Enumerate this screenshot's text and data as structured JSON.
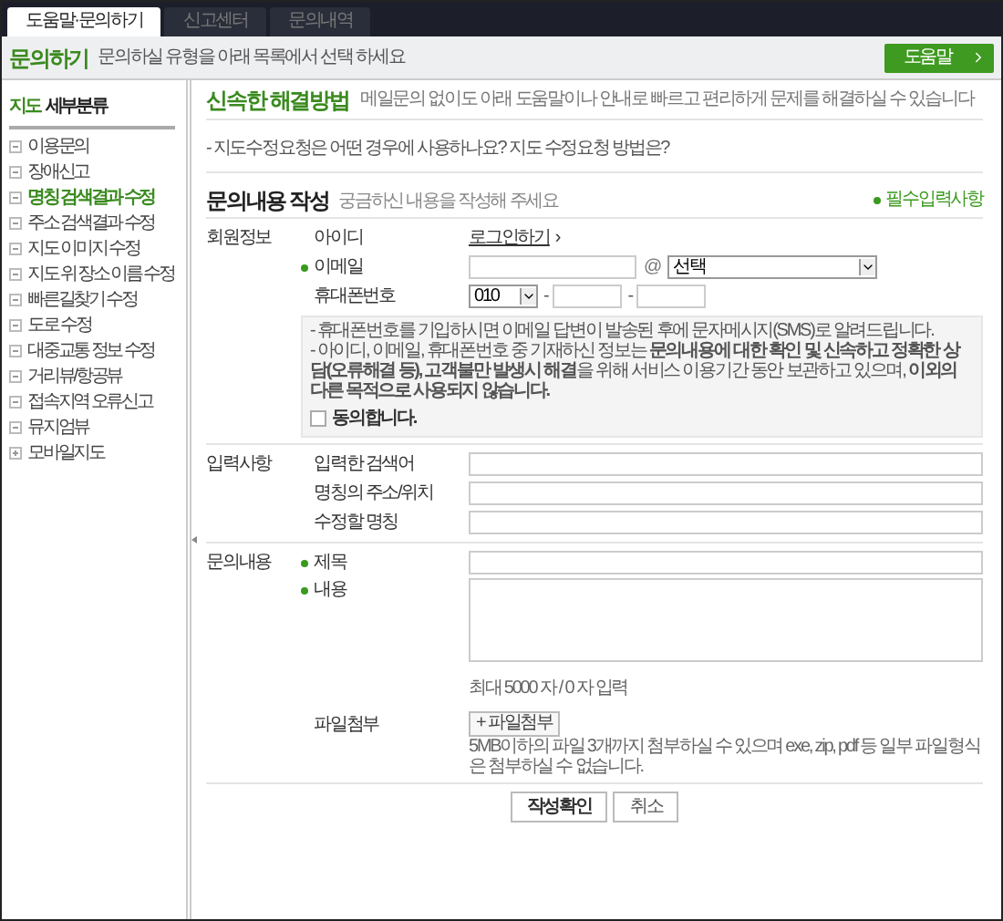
{
  "tabs": [
    {
      "label": "도움말·문의하기",
      "selected": true
    },
    {
      "label": "신고센터",
      "selected": false
    },
    {
      "label": "문의내역",
      "selected": false
    }
  ],
  "header": {
    "title": "문의하기",
    "subtitle": "문의하실 유형을 아래 목록에서 선택 하세요",
    "help_button": "도움말"
  },
  "sidebar": {
    "title_highlight": "지도",
    "title": "세부분류",
    "items": [
      {
        "label": "이용문의",
        "selected": false,
        "expanded": true
      },
      {
        "label": "장애신고",
        "selected": false,
        "expanded": true
      },
      {
        "label": "명칭 검색결과 수정",
        "selected": true,
        "expanded": true
      },
      {
        "label": "주소 검색결과 수정",
        "selected": false,
        "expanded": true
      },
      {
        "label": "지도 이미지 수정",
        "selected": false,
        "expanded": true
      },
      {
        "label": "지도 위 장소 이름 수정",
        "selected": false,
        "expanded": true
      },
      {
        "label": "빠른길찾기 수정",
        "selected": false,
        "expanded": true
      },
      {
        "label": "도로 수정",
        "selected": false,
        "expanded": true
      },
      {
        "label": "대중교통 정보 수정",
        "selected": false,
        "expanded": true
      },
      {
        "label": "거리뷰/항공뷰",
        "selected": false,
        "expanded": true
      },
      {
        "label": "접속지역 오류신고",
        "selected": false,
        "expanded": true
      },
      {
        "label": "뮤지엄뷰",
        "selected": false,
        "expanded": true
      },
      {
        "label": "모바일지도",
        "selected": false,
        "expanded": false
      }
    ]
  },
  "solution": {
    "title": "신속한 해결방법",
    "description": "메일문의 없이도 아래 도움말이나 안내로 빠르고 편리하게 문제를 해결하실 수 있습니다",
    "faq": "- 지도수정요청은 어떤 경우에 사용하나요? 지도 수정요청 방법은?"
  },
  "form": {
    "title": "문의내용 작성",
    "subtitle": "궁금하신 내용을 작성해 주세요",
    "required_note": "필수입력사항"
  },
  "member": {
    "label": "회원정보",
    "id_label": "아이디",
    "login_link": "로그인하기",
    "login_arrow": "›",
    "email": {
      "label": "이메일",
      "required": true,
      "at": "@",
      "domain": "선택"
    },
    "phone": {
      "label": "휴대폰번호",
      "prefix": "010",
      "dashes": [
        "-",
        "-"
      ]
    },
    "notice": [
      "- 휴대폰번호를 기입하시면 이메일 답변이 발송된 후에 문자메시지(SMS)로 알려드립니다.",
      "- 아이디, 이메일, 휴대폰번호 중 기재하신 정보는 **문의내용에 대한 확인 및 신속하고 정확한 상담(오류해결 등), 고객불만 발생시 해결**을 위해 서비스 이용기간 동안 보관하고 있으며, **이외의 다른 목적으로 사용되지 않습니다.**"
    ],
    "agree": {
      "label": "동의합니다.",
      "checked": false
    }
  },
  "input_section": {
    "label": "입력사항",
    "fields": [
      {
        "label": "입력한 검색어"
      },
      {
        "label": "명칭의 주소/위치"
      },
      {
        "label": "수정할 명칭"
      }
    ]
  },
  "inquiry": {
    "label": "문의내용",
    "title_label": "제목",
    "title_required": true,
    "content_label": "내용",
    "content_required": true,
    "count": "최대 5000 자 / 0 자 입력",
    "file_label": "파일첨부",
    "file_button": "+ 파일첨부",
    "file_note": "5MB이하의 파일 3개까지 첨부하실 수 있으며 exe, zip, pdf 등 일부 파일형식은 첨부하실 수 없습니다."
  },
  "buttons": [
    {
      "label": "작성확인",
      "kind": "primary"
    },
    {
      "label": "취소",
      "kind": "secondary"
    }
  ]
}
